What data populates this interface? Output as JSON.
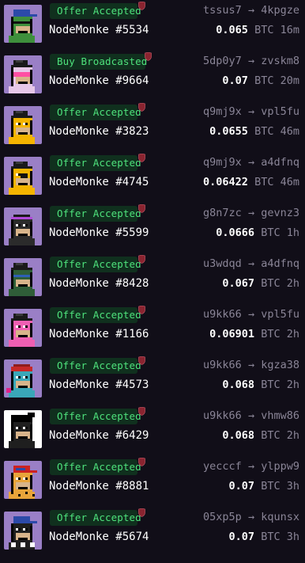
{
  "collection": "NodeMonke",
  "colors": {
    "background": "#110e18",
    "badge_bg": "#10301e",
    "badge_text": "#4ee27c",
    "shield": "#8a2430",
    "muted": "#8a8597"
  },
  "arrow": "→",
  "currency": "BTC",
  "sales": [
    {
      "status": "Offer Accepted",
      "name": "NodeMonke #5534",
      "from": "tssus7",
      "to": "4kpgze",
      "price": "0.065",
      "age": "16m",
      "bg": "#9a7fc6",
      "face": "#3e8f3c",
      "hat": "blue-cap",
      "extra": "sunglasses"
    },
    {
      "status": "Buy Broadcasted",
      "name": "NodeMonke #9664",
      "from": "5dp0y7",
      "to": "zvskm8",
      "price": "0.07",
      "age": "20m",
      "bg": "#9a7fc6",
      "face": "#e7c8e8",
      "hat": "bowler",
      "extra": "pink-visor"
    },
    {
      "status": "Offer Accepted",
      "name": "NodeMonke #3823",
      "from": "q9mj9x",
      "to": "vpl5fu",
      "price": "0.0655",
      "age": "46m",
      "bg": "#9a7fc6",
      "face": "#f5b400",
      "hat": "bowler",
      "extra": "none"
    },
    {
      "status": "Offer Accepted",
      "name": "NodeMonke #4745",
      "from": "q9mj9x",
      "to": "a4dfnq",
      "price": "0.06422",
      "age": "46m",
      "bg": "#9a7fc6",
      "face": "#f5b400",
      "hat": "bowler",
      "extra": "eyepatch"
    },
    {
      "status": "Offer Accepted",
      "name": "NodeMonke #5599",
      "from": "g8n7zc",
      "to": "gevnz3",
      "price": "0.0666",
      "age": "1h",
      "bg": "#9a7fc6",
      "face": "#2b2b2b",
      "hat": "headband",
      "extra": "none"
    },
    {
      "status": "Offer Accepted",
      "name": "NodeMonke #8428",
      "from": "u3wdqd",
      "to": "a4dfnq",
      "price": "0.067",
      "age": "2h",
      "bg": "#9a7fc6",
      "face": "#2f5d38",
      "hat": "bowler",
      "extra": "blue-mask"
    },
    {
      "status": "Offer Accepted",
      "name": "NodeMonke #1166",
      "from": "u9kk66",
      "to": "vpl5fu",
      "price": "0.06901",
      "age": "2h",
      "bg": "#9a7fc6",
      "face": "#ef5fb2",
      "hat": "bowler",
      "extra": "none"
    },
    {
      "status": "Offer Accepted",
      "name": "NodeMonke #4573",
      "from": "u9kk66",
      "to": "kgza38",
      "price": "0.068",
      "age": "2h",
      "bg": "#9a7fc6",
      "face": "#3aa7b8",
      "hat": "red-bandana",
      "extra": "heart"
    },
    {
      "status": "Offer Accepted",
      "name": "NodeMonke #6429",
      "from": "u9kk66",
      "to": "vhmw86",
      "price": "0.068",
      "age": "2h",
      "bg": "#ffffff",
      "face": "#1f1f1f",
      "hat": "black-hair",
      "extra": "none"
    },
    {
      "status": "Offer Accepted",
      "name": "NodeMonke #8881",
      "from": "yecccf",
      "to": "ylppw9",
      "price": "0.07",
      "age": "3h",
      "bg": "#9a7fc6",
      "face": "#e8a43a",
      "hat": "red-cap",
      "extra": "spots"
    },
    {
      "status": "Offer Accepted",
      "name": "NodeMonke #5674",
      "from": "05xp5p",
      "to": "kqunsx",
      "price": "0.07",
      "age": "3h",
      "bg": "#9a7fc6",
      "face": "#1f1f1f",
      "hat": "blue-cap",
      "extra": "checker"
    }
  ]
}
